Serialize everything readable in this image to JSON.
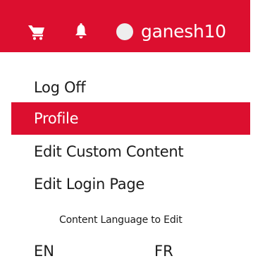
{
  "header": {
    "cart_icon": "cart-icon",
    "bell_icon": "bell-icon",
    "username": "ganesh10",
    "accent_color": "#dc0f2f"
  },
  "menu": {
    "items": [
      {
        "label": "Log Off",
        "active": false
      },
      {
        "label": "Profile",
        "active": true
      },
      {
        "label": "Edit Custom Content",
        "active": false
      },
      {
        "label": "Edit Login Page",
        "active": false
      }
    ]
  },
  "language": {
    "heading": "Content Language to Edit",
    "options": [
      "EN",
      "FR"
    ]
  }
}
